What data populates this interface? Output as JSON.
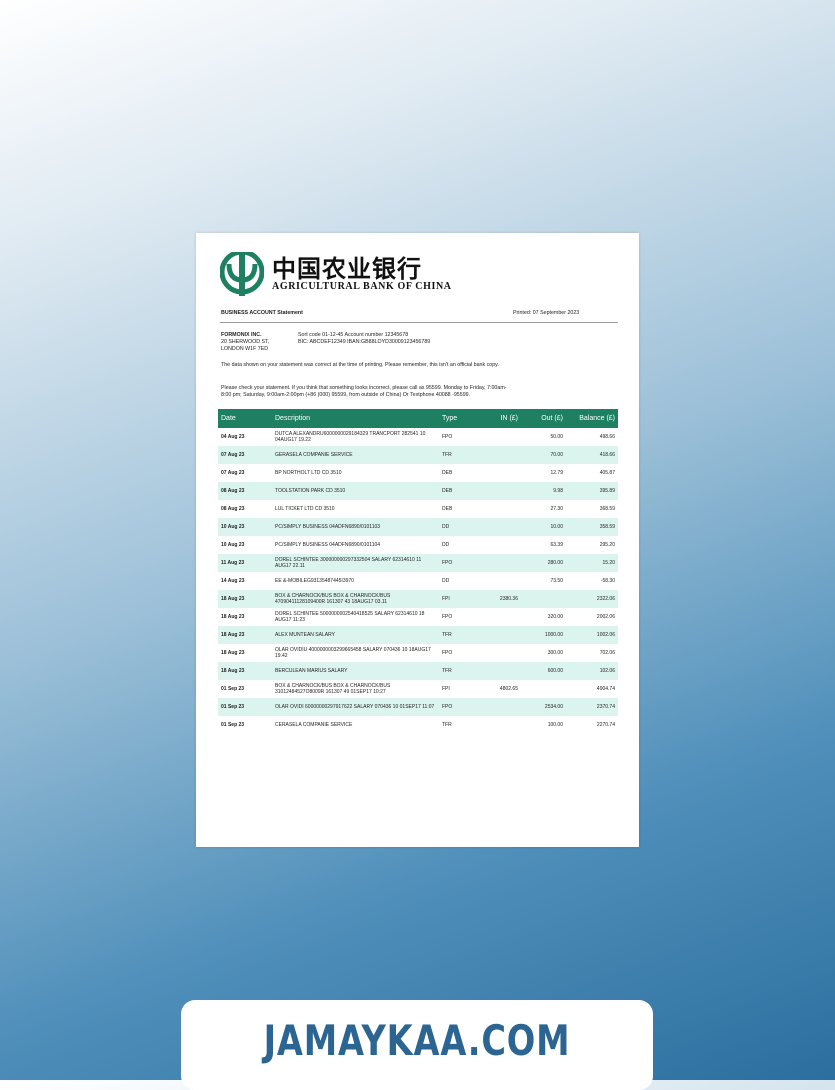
{
  "bank": {
    "name_cn": "中国农业银行",
    "name_en": "AGRICULTURAL BANK OF CHINA",
    "logo_color": "#1e8060"
  },
  "statement": {
    "title": "BUSINESS ACCOUNT Statement",
    "printed": "Printed: 07 September 2023",
    "company": "FORMONIX INC.",
    "address_1": "20 SHERWOOD ST,",
    "address_2": "LONDON W1F 7ED",
    "sort_line": "Sort code 01-12-45  Account number 12345678",
    "bic_line": "BIC: ABCDEF12349  IBAN:GB88LOYD30009123456789",
    "note_1": "The data shown on your statement was correct at the time of printing. Please remember, this isn't an official bank copy.",
    "note_2a": "Please check your statement. If you think that something looks incorrect, please call as 95599. Monday to Friday, 7:00am-",
    "note_2b": "8:00 pm; Saturday, 9:00am-2:00pm (+86 (000) 95599, from outside of China)  Or Textphone 40088 -95599."
  },
  "table": {
    "headers": [
      "Date",
      "Description",
      "Type",
      "IN (£)",
      "Out (£)",
      "Balance (£)"
    ],
    "rows": [
      {
        "date": "04 Aug 23",
        "desc": "DUTCA ALEXANDRU6000000029184329 TRANCPORT 282541 10 04AUG17 19.22",
        "type": "FPO",
        "in": "",
        "out": "50.00",
        "bal": "498.66"
      },
      {
        "date": "07 Aug 23",
        "desc": "GERASELA COMPANIE SERVICE",
        "type": "TFR",
        "in": "",
        "out": "70.00",
        "bal": "418.66"
      },
      {
        "date": "07 Aug 23",
        "desc": "BP NORTHOLT LTD CD 3510",
        "type": "DEB",
        "in": "",
        "out": "12.79",
        "bal": "405.87"
      },
      {
        "date": "08 Aug 23",
        "desc": "TOOLSTATION PARK CD 3510",
        "type": "DEB",
        "in": "",
        "out": "9.98",
        "bal": "395.89"
      },
      {
        "date": "08 Aug 23",
        "desc": "LUL TICKET LTD CD 3510",
        "type": "DEB",
        "in": "",
        "out": "27.30",
        "bal": "368.59"
      },
      {
        "date": "10 Aug 23",
        "desc": "PC/SIMPLY BUSINESS 04ADFN6890/0101103",
        "type": "DD",
        "in": "",
        "out": "10.00",
        "bal": "358.59"
      },
      {
        "date": "10 Aug 23",
        "desc": "PC/SIMPLY BUSINESS 04ADFN6890/0101104",
        "type": "DD",
        "in": "",
        "out": "63.39",
        "bal": "295.20"
      },
      {
        "date": "11 Aug 23",
        "desc": "DOREL SCHINTEE 300000000297332504 SALARY 62314610 11 AUG17 22.11",
        "type": "FPO",
        "in": "",
        "out": "280.00",
        "bal": "15.20"
      },
      {
        "date": "14 Aug 23",
        "desc": "EE &-MOBILEG93135487445I3970",
        "type": "DD",
        "in": "",
        "out": "73.50",
        "bal": "-58.30"
      },
      {
        "date": "18 Aug 23",
        "desc": "BOX & CHARNOCK/BUS BOX & CHARNOCK/BUS 47090411128109400R 161307 43 18AUG17 03.11",
        "type": "FPI",
        "in": "2380.36",
        "out": "",
        "bal": "2322.06"
      },
      {
        "date": "18 Aug 23",
        "desc": "DOREL SCHINTEE 5000000002540418525 SALARY 62314610 18 AUG17 11:23",
        "type": "FPO",
        "in": "",
        "out": "320.00",
        "bal": "2002.06"
      },
      {
        "date": "18 Aug 23",
        "desc": "ALEX MUNTEAN SALARY",
        "type": "TFR",
        "in": "",
        "out": "1000.00",
        "bal": "1002.06"
      },
      {
        "date": "18 Aug 23",
        "desc": "OLAR OVIDIU 4000000003299665458 SALARY 070436 10 18AUG17 19.42",
        "type": "FPO",
        "in": "",
        "out": "300.00",
        "bal": "702.06"
      },
      {
        "date": "18 Aug 23",
        "desc": "BERCULEAN MARIUS SALARY",
        "type": "TFR",
        "in": "",
        "out": "600.00",
        "bal": "102.06"
      },
      {
        "date": "01 Sep 23",
        "desc": "BOX & CHARNOCK/BUS BOX & CHARNOCK/BUS 31012484527O8009R 161307 49 01SEP17 10:27",
        "type": "FPI",
        "in": "4802.65",
        "out": "",
        "bal": "4904.74"
      },
      {
        "date": "01 Sep 23",
        "desc": "OLAR OVIDI 60000000297917622 SALARY 070436 10 01SEP17 11:07",
        "type": "FPO",
        "in": "",
        "out": "2534.00",
        "bal": "2370.74"
      },
      {
        "date": "01 Sep 23",
        "desc": "CERASELA COMPANIE SERVICE",
        "type": "TFR",
        "in": "",
        "out": "100.00",
        "bal": "2270.74"
      }
    ]
  },
  "footer": {
    "brand": "JAMAYKAA.COM"
  }
}
